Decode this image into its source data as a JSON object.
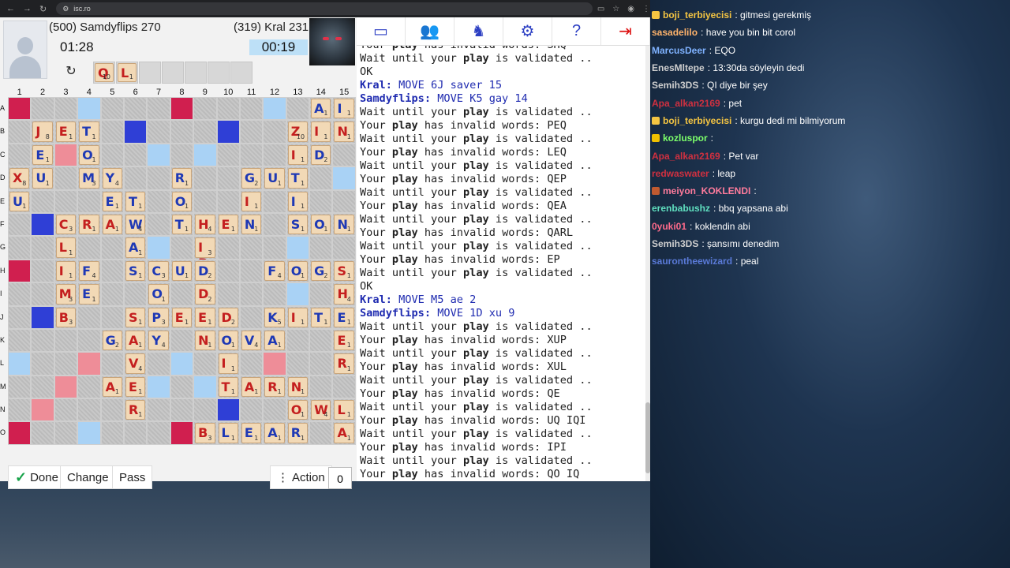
{
  "browser": {
    "url": "isc.ro",
    "nav_back": "←",
    "nav_forward": "→",
    "nav_reload": "↻"
  },
  "players": {
    "p1": {
      "name": "(500) Samdyflips 270",
      "time": "01:28"
    },
    "p2": {
      "name": "(319) Kral 231",
      "time": "00:19"
    }
  },
  "rack": [
    {
      "letter": "Q",
      "value": "10"
    },
    {
      "letter": "L",
      "value": "1"
    }
  ],
  "board": {
    "columns": [
      "1",
      "2",
      "3",
      "4",
      "5",
      "6",
      "7",
      "8",
      "9",
      "10",
      "11",
      "12",
      "13",
      "14",
      "15"
    ],
    "rows": [
      "A",
      "B",
      "C",
      "D",
      "E",
      "F",
      "G",
      "H",
      "I",
      "J",
      "K",
      "L",
      "M",
      "N",
      "O"
    ],
    "premium": {
      "tw": [
        [
          0,
          0
        ],
        [
          0,
          7
        ],
        [
          7,
          0
        ],
        [
          14,
          0
        ],
        [
          14,
          7
        ]
      ],
      "dw": [
        [
          2,
          2
        ],
        [
          11,
          3
        ],
        [
          12,
          2
        ],
        [
          13,
          1
        ],
        [
          11,
          11
        ]
      ],
      "tl": [
        [
          1,
          5
        ],
        [
          1,
          9
        ],
        [
          5,
          1
        ],
        [
          9,
          1
        ],
        [
          13,
          9
        ]
      ],
      "dl": [
        [
          0,
          3
        ],
        [
          0,
          11
        ],
        [
          2,
          6
        ],
        [
          2,
          8
        ],
        [
          3,
          14
        ],
        [
          6,
          6
        ],
        [
          6,
          12
        ],
        [
          8,
          12
        ],
        [
          11,
          0
        ],
        [
          11,
          7
        ],
        [
          12,
          6
        ],
        [
          12,
          8
        ],
        [
          14,
          3
        ]
      ]
    },
    "tiles": [
      {
        "r": 0,
        "c": 13,
        "l": "A",
        "v": "1",
        "color": "blue"
      },
      {
        "r": 0,
        "c": 14,
        "l": "I",
        "v": "1",
        "color": "blue"
      },
      {
        "r": 1,
        "c": 1,
        "l": "J",
        "v": "8",
        "color": "red"
      },
      {
        "r": 1,
        "c": 2,
        "l": "E",
        "v": "1",
        "color": "red"
      },
      {
        "r": 1,
        "c": 3,
        "l": "T",
        "v": "1",
        "color": "blue"
      },
      {
        "r": 1,
        "c": 12,
        "l": "Z",
        "v": "10",
        "color": "red"
      },
      {
        "r": 1,
        "c": 13,
        "l": "I",
        "v": "1",
        "color": "red"
      },
      {
        "r": 1,
        "c": 14,
        "l": "N",
        "v": "1",
        "color": "red"
      },
      {
        "r": 2,
        "c": 1,
        "l": "E",
        "v": "1",
        "color": "blue"
      },
      {
        "r": 2,
        "c": 3,
        "l": "O",
        "v": "1",
        "color": "blue"
      },
      {
        "r": 2,
        "c": 12,
        "l": "I",
        "v": "1",
        "color": "red"
      },
      {
        "r": 2,
        "c": 13,
        "l": "D",
        "v": "2",
        "color": "blue"
      },
      {
        "r": 3,
        "c": 0,
        "l": "X",
        "v": "8",
        "color": "red"
      },
      {
        "r": 3,
        "c": 1,
        "l": "U",
        "v": "1",
        "color": "blue"
      },
      {
        "r": 3,
        "c": 3,
        "l": "M",
        "v": "3",
        "color": "blue"
      },
      {
        "r": 3,
        "c": 4,
        "l": "Y",
        "v": "4",
        "color": "blue"
      },
      {
        "r": 3,
        "c": 7,
        "l": "R",
        "v": "1",
        "color": "blue"
      },
      {
        "r": 3,
        "c": 10,
        "l": "G",
        "v": "2",
        "color": "blue"
      },
      {
        "r": 3,
        "c": 11,
        "l": "U",
        "v": "1",
        "color": "blue"
      },
      {
        "r": 3,
        "c": 12,
        "l": "T",
        "v": "1",
        "color": "blue"
      },
      {
        "r": 4,
        "c": 0,
        "l": "U",
        "v": "1",
        "color": "blue"
      },
      {
        "r": 4,
        "c": 4,
        "l": "E",
        "v": "1",
        "color": "blue"
      },
      {
        "r": 4,
        "c": 5,
        "l": "T",
        "v": "1",
        "color": "blue"
      },
      {
        "r": 4,
        "c": 7,
        "l": "O",
        "v": "1",
        "color": "blue"
      },
      {
        "r": 4,
        "c": 10,
        "l": "I",
        "v": "1",
        "color": "red"
      },
      {
        "r": 4,
        "c": 12,
        "l": "I",
        "v": "1",
        "color": "blue"
      },
      {
        "r": 5,
        "c": 2,
        "l": "C",
        "v": "3",
        "color": "red"
      },
      {
        "r": 5,
        "c": 3,
        "l": "R",
        "v": "1",
        "color": "red"
      },
      {
        "r": 5,
        "c": 4,
        "l": "A",
        "v": "1",
        "color": "red"
      },
      {
        "r": 5,
        "c": 5,
        "l": "W",
        "v": "4",
        "color": "blue"
      },
      {
        "r": 5,
        "c": 7,
        "l": "T",
        "v": "1",
        "color": "blue"
      },
      {
        "r": 5,
        "c": 8,
        "l": "H",
        "v": "4",
        "color": "red"
      },
      {
        "r": 5,
        "c": 9,
        "l": "E",
        "v": "1",
        "color": "red"
      },
      {
        "r": 5,
        "c": 10,
        "l": "N",
        "v": "1",
        "color": "blue"
      },
      {
        "r": 5,
        "c": 12,
        "l": "S",
        "v": "1",
        "color": "blue"
      },
      {
        "r": 5,
        "c": 13,
        "l": "O",
        "v": "1",
        "color": "blue"
      },
      {
        "r": 5,
        "c": 14,
        "l": "N",
        "v": "1",
        "color": "blue"
      },
      {
        "r": 6,
        "c": 2,
        "l": "L",
        "v": "1",
        "color": "red"
      },
      {
        "r": 6,
        "c": 5,
        "l": "A",
        "v": "1",
        "color": "blue"
      },
      {
        "r": 6,
        "c": 8,
        "l": "P",
        "v": "3",
        "color": "red",
        "extra": "I"
      },
      {
        "r": 7,
        "c": 2,
        "l": "I",
        "v": "1",
        "color": "red"
      },
      {
        "r": 7,
        "c": 3,
        "l": "F",
        "v": "4",
        "color": "blue"
      },
      {
        "r": 7,
        "c": 5,
        "l": "S",
        "v": "1",
        "color": "blue"
      },
      {
        "r": 7,
        "c": 6,
        "l": "C",
        "v": "3",
        "color": "blue"
      },
      {
        "r": 7,
        "c": 7,
        "l": "U",
        "v": "1",
        "color": "blue"
      },
      {
        "r": 7,
        "c": 8,
        "l": "D",
        "v": "2",
        "color": "blue"
      },
      {
        "r": 7,
        "c": 11,
        "l": "F",
        "v": "4",
        "color": "blue"
      },
      {
        "r": 7,
        "c": 12,
        "l": "O",
        "v": "1",
        "color": "blue"
      },
      {
        "r": 7,
        "c": 13,
        "l": "G",
        "v": "2",
        "color": "blue"
      },
      {
        "r": 7,
        "c": 14,
        "l": "S",
        "v": "1",
        "color": "red"
      },
      {
        "r": 8,
        "c": 2,
        "l": "M",
        "v": "3",
        "color": "red"
      },
      {
        "r": 8,
        "c": 3,
        "l": "E",
        "v": "1",
        "color": "blue"
      },
      {
        "r": 8,
        "c": 6,
        "l": "O",
        "v": "1",
        "color": "blue"
      },
      {
        "r": 8,
        "c": 8,
        "l": "D",
        "v": "2",
        "color": "red"
      },
      {
        "r": 8,
        "c": 14,
        "l": "H",
        "v": "4",
        "color": "red"
      },
      {
        "r": 9,
        "c": 2,
        "l": "B",
        "v": "3",
        "color": "red"
      },
      {
        "r": 9,
        "c": 5,
        "l": "S",
        "v": "1",
        "color": "red"
      },
      {
        "r": 9,
        "c": 6,
        "l": "P",
        "v": "3",
        "color": "blue"
      },
      {
        "r": 9,
        "c": 7,
        "l": "E",
        "v": "1",
        "color": "red"
      },
      {
        "r": 9,
        "c": 8,
        "l": "E",
        "v": "1",
        "color": "red"
      },
      {
        "r": 9,
        "c": 9,
        "l": "D",
        "v": "2",
        "color": "red"
      },
      {
        "r": 9,
        "c": 11,
        "l": "K",
        "v": "5",
        "color": "blue"
      },
      {
        "r": 9,
        "c": 12,
        "l": "I",
        "v": "1",
        "color": "red"
      },
      {
        "r": 9,
        "c": 13,
        "l": "T",
        "v": "1",
        "color": "blue"
      },
      {
        "r": 9,
        "c": 14,
        "l": "E",
        "v": "1",
        "color": "blue"
      },
      {
        "r": 10,
        "c": 4,
        "l": "G",
        "v": "2",
        "color": "blue"
      },
      {
        "r": 10,
        "c": 5,
        "l": "A",
        "v": "1",
        "color": "red"
      },
      {
        "r": 10,
        "c": 6,
        "l": "Y",
        "v": "4",
        "color": "blue"
      },
      {
        "r": 10,
        "c": 8,
        "l": "N",
        "v": "1",
        "color": "red"
      },
      {
        "r": 10,
        "c": 9,
        "l": "O",
        "v": "1",
        "color": "blue"
      },
      {
        "r": 10,
        "c": 10,
        "l": "V",
        "v": "4",
        "color": "blue"
      },
      {
        "r": 10,
        "c": 11,
        "l": "A",
        "v": "1",
        "color": "blue"
      },
      {
        "r": 10,
        "c": 14,
        "l": "E",
        "v": "1",
        "color": "red"
      },
      {
        "r": 11,
        "c": 5,
        "l": "V",
        "v": "4",
        "color": "red"
      },
      {
        "r": 11,
        "c": 9,
        "l": "I",
        "v": "1",
        "color": "red"
      },
      {
        "r": 11,
        "c": 14,
        "l": "R",
        "v": "1",
        "color": "red"
      },
      {
        "r": 12,
        "c": 4,
        "l": "A",
        "v": "1",
        "color": "red"
      },
      {
        "r": 12,
        "c": 5,
        "l": "E",
        "v": "1",
        "color": "red"
      },
      {
        "r": 12,
        "c": 9,
        "l": "T",
        "v": "1",
        "color": "red"
      },
      {
        "r": 12,
        "c": 10,
        "l": "A",
        "v": "1",
        "color": "red"
      },
      {
        "r": 12,
        "c": 11,
        "l": "R",
        "v": "1",
        "color": "red"
      },
      {
        "r": 12,
        "c": 12,
        "l": "N",
        "v": "1",
        "color": "red"
      },
      {
        "r": 13,
        "c": 5,
        "l": "R",
        "v": "1",
        "color": "red"
      },
      {
        "r": 13,
        "c": 12,
        "l": "O",
        "v": "1",
        "color": "red"
      },
      {
        "r": 13,
        "c": 13,
        "l": "W",
        "v": "4",
        "color": "red"
      },
      {
        "r": 13,
        "c": 14,
        "l": "L",
        "v": "1",
        "color": "red"
      },
      {
        "r": 14,
        "c": 8,
        "l": "B",
        "v": "3",
        "color": "red"
      },
      {
        "r": 14,
        "c": 9,
        "l": "L",
        "v": "1",
        "color": "blue"
      },
      {
        "r": 14,
        "c": 10,
        "l": "E",
        "v": "1",
        "color": "blue"
      },
      {
        "r": 14,
        "c": 11,
        "l": "A",
        "v": "1",
        "color": "blue"
      },
      {
        "r": 14,
        "c": 12,
        "l": "R",
        "v": "1",
        "color": "blue"
      },
      {
        "r": 14,
        "c": 14,
        "l": "A",
        "v": "1",
        "color": "red"
      }
    ]
  },
  "buttons": {
    "done": "Done",
    "change": "Change",
    "pass": "Pass",
    "action": "Action",
    "bag_count": "0"
  },
  "toolbar_icons": [
    "window-icon",
    "users-icon",
    "chess-icon",
    "gear-icon",
    "help-icon",
    "exit-icon"
  ],
  "log": [
    {
      "type": "text",
      "text": "Your play has invalid words: SHQ"
    },
    {
      "type": "text",
      "text": "Wait until your play is validated .."
    },
    {
      "type": "text",
      "text": "OK"
    },
    {
      "type": "move",
      "who": "Kral:",
      "rest": " MOVE 6J saver 15"
    },
    {
      "type": "move",
      "who": "Samdyflips:",
      "rest": " MOVE K5 gay 14"
    },
    {
      "type": "text",
      "text": "Wait until your play is validated .."
    },
    {
      "type": "text",
      "text": "Your play has invalid words: PEQ"
    },
    {
      "type": "text",
      "text": "Wait until your play is validated .."
    },
    {
      "type": "text",
      "text": "Your play has invalid words: LEQ"
    },
    {
      "type": "text",
      "text": "Wait until your play is validated .."
    },
    {
      "type": "text",
      "text": "Your play has invalid words: QEP"
    },
    {
      "type": "text",
      "text": "Wait until your play is validated .."
    },
    {
      "type": "text",
      "text": "Your play has invalid words: QEA"
    },
    {
      "type": "text",
      "text": "Wait until your play is validated .."
    },
    {
      "type": "text",
      "text": "Your play has invalid words: QARL"
    },
    {
      "type": "text",
      "text": "Wait until your play is validated .."
    },
    {
      "type": "text",
      "text": "Your play has invalid words: EP"
    },
    {
      "type": "text",
      "text": "Wait until your play is validated .."
    },
    {
      "type": "text",
      "text": "OK"
    },
    {
      "type": "move",
      "who": "Kral:",
      "rest": " MOVE M5 ae 2"
    },
    {
      "type": "move",
      "who": "Samdyflips:",
      "rest": " MOVE 1D xu 9"
    },
    {
      "type": "text",
      "text": "Wait until your play is validated .."
    },
    {
      "type": "text",
      "text": "Your play has invalid words: XUP"
    },
    {
      "type": "text",
      "text": "Wait until your play is validated .."
    },
    {
      "type": "text",
      "text": "Your play has invalid words: XUL"
    },
    {
      "type": "text",
      "text": "Wait until your play is validated .."
    },
    {
      "type": "text",
      "text": "Your play has invalid words: QE"
    },
    {
      "type": "text",
      "text": "Wait until your play is validated .."
    },
    {
      "type": "text",
      "text": "Your play has invalid words: UQ IQI"
    },
    {
      "type": "text",
      "text": "Wait until your play is validated .."
    },
    {
      "type": "text",
      "text": "Your play has invalid words: IPI"
    },
    {
      "type": "text",
      "text": "Wait until your play is validated .."
    },
    {
      "type": "text",
      "text": "Your play has invalid words: QO IQ"
    },
    {
      "type": "text",
      "text": "Wait until your play is validated .."
    }
  ],
  "chat": [
    {
      "user": "boji_terbiyecisi",
      "text": "gitmesi gerekmiş",
      "color": "#f5c542",
      "badge": "#f5c542"
    },
    {
      "user": "sasadelilo",
      "text": "have you bin bit corol",
      "color": "#ffb36b"
    },
    {
      "user": "MarcusDeer",
      "text": "EQO",
      "color": "#7fb2ff"
    },
    {
      "user": "EnesMltepe",
      "text": "13:30da söyleyin dedi",
      "color": "#cfcfcf"
    },
    {
      "user": "Semih3DS",
      "text": "QI diye bir şey",
      "color": "#cfcfcf"
    },
    {
      "user": "Apa_alkan2169",
      "text": "pet",
      "color": "#d03040"
    },
    {
      "user": "boji_terbiyecisi",
      "text": "kurgu dedi mi bilmiyorum",
      "color": "#f5c542",
      "badge": "#f5c542"
    },
    {
      "user": "kozluspor",
      "text": "",
      "color": "#7dff6b",
      "badge": "#f0c000"
    },
    {
      "user": "Apa_alkan2169",
      "text": "Pet var",
      "color": "#d03040"
    },
    {
      "user": "redwaswater",
      "text": "leap",
      "color": "#d03040"
    },
    {
      "user": "meiyon_KOKLENDI",
      "text": "",
      "color": "#ff7b9c",
      "badge": "#c05a30"
    },
    {
      "user": "erenbabushz",
      "text": "bbq yapsana abi",
      "color": "#60e0c0"
    },
    {
      "user": "0yuki01",
      "text": "koklendin abi",
      "color": "#ff6b8b"
    },
    {
      "user": "Semih3DS",
      "text": "şansımı denedim",
      "color": "#cfcfcf"
    },
    {
      "user": "saurontheewizard",
      "text": "peal",
      "color": "#5a7ad8"
    }
  ]
}
